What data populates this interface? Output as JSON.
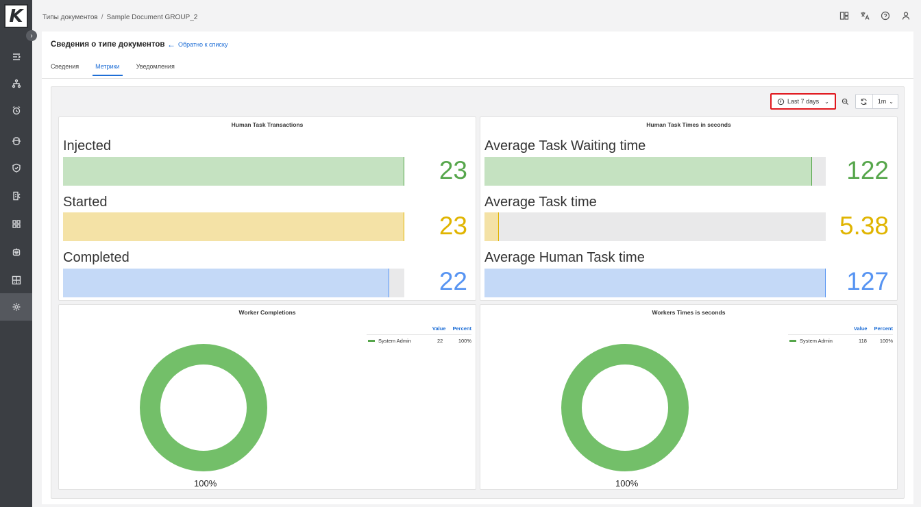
{
  "app": {
    "logo_letter": "K"
  },
  "breadcrumb": {
    "parent": "Типы документов",
    "separator": "/",
    "current": "Sample Document GROUP_2"
  },
  "sidebar": {
    "items": [
      {
        "icon": "workflow-icon"
      },
      {
        "icon": "hierarchy-icon"
      },
      {
        "icon": "alarm-clock-icon"
      },
      {
        "icon": "database-sync-icon"
      },
      {
        "icon": "shield-icon"
      },
      {
        "icon": "document-list-icon"
      },
      {
        "icon": "grid-icon"
      },
      {
        "icon": "robot-icon"
      },
      {
        "icon": "dashboard-icon"
      },
      {
        "icon": "settings-icon",
        "active": true
      }
    ]
  },
  "top_icons": [
    "layout-icon",
    "translate-icon",
    "help-icon",
    "user-icon"
  ],
  "header": {
    "title": "Сведения о типе документов",
    "back_link": "Обратно к списку",
    "tabs": [
      {
        "label": "Сведения",
        "active": false
      },
      {
        "label": "Метрики",
        "active": true
      },
      {
        "label": "Уведомления",
        "active": false
      }
    ]
  },
  "toolbar": {
    "time_range": "Last 7 days",
    "refresh_interval": "1m"
  },
  "colors": {
    "green": "#56a64b",
    "yellow": "#e0b400",
    "blue": "#5794f2",
    "green_fill": "#c5e2c1",
    "yellow_fill": "#f4e2a6",
    "blue_fill": "#c4d9f7"
  },
  "panels": {
    "transactions": {
      "title": "Human Task Transactions",
      "rows": [
        {
          "label": "Injected",
          "value": "23",
          "fill": 1.0,
          "color": "green"
        },
        {
          "label": "Started",
          "value": "23",
          "fill": 1.0,
          "color": "yellow"
        },
        {
          "label": "Completed",
          "value": "22",
          "fill": 0.956,
          "color": "blue"
        }
      ]
    },
    "times": {
      "title": "Human Task Times in seconds",
      "rows": [
        {
          "label": "Average Task Waiting time",
          "value": "122",
          "fill": 0.96,
          "color": "green"
        },
        {
          "label": "Average Task time",
          "value": "5.38",
          "fill": 0.042,
          "color": "yellow"
        },
        {
          "label": "Average Human Task time",
          "value": "127",
          "fill": 1.0,
          "color": "blue"
        }
      ]
    },
    "worker_completions": {
      "title": "Worker Completions",
      "legend_headers": {
        "value": "Value",
        "percent": "Percent"
      },
      "legend": [
        {
          "name": "System Admin",
          "value": "22",
          "percent": "100%"
        }
      ],
      "donut_label": "100%"
    },
    "worker_times": {
      "title": "Workers Times is seconds",
      "legend_headers": {
        "value": "Value",
        "percent": "Percent"
      },
      "legend": [
        {
          "name": "System Admin",
          "value": "118",
          "percent": "100%"
        }
      ],
      "donut_label": "100%"
    }
  }
}
